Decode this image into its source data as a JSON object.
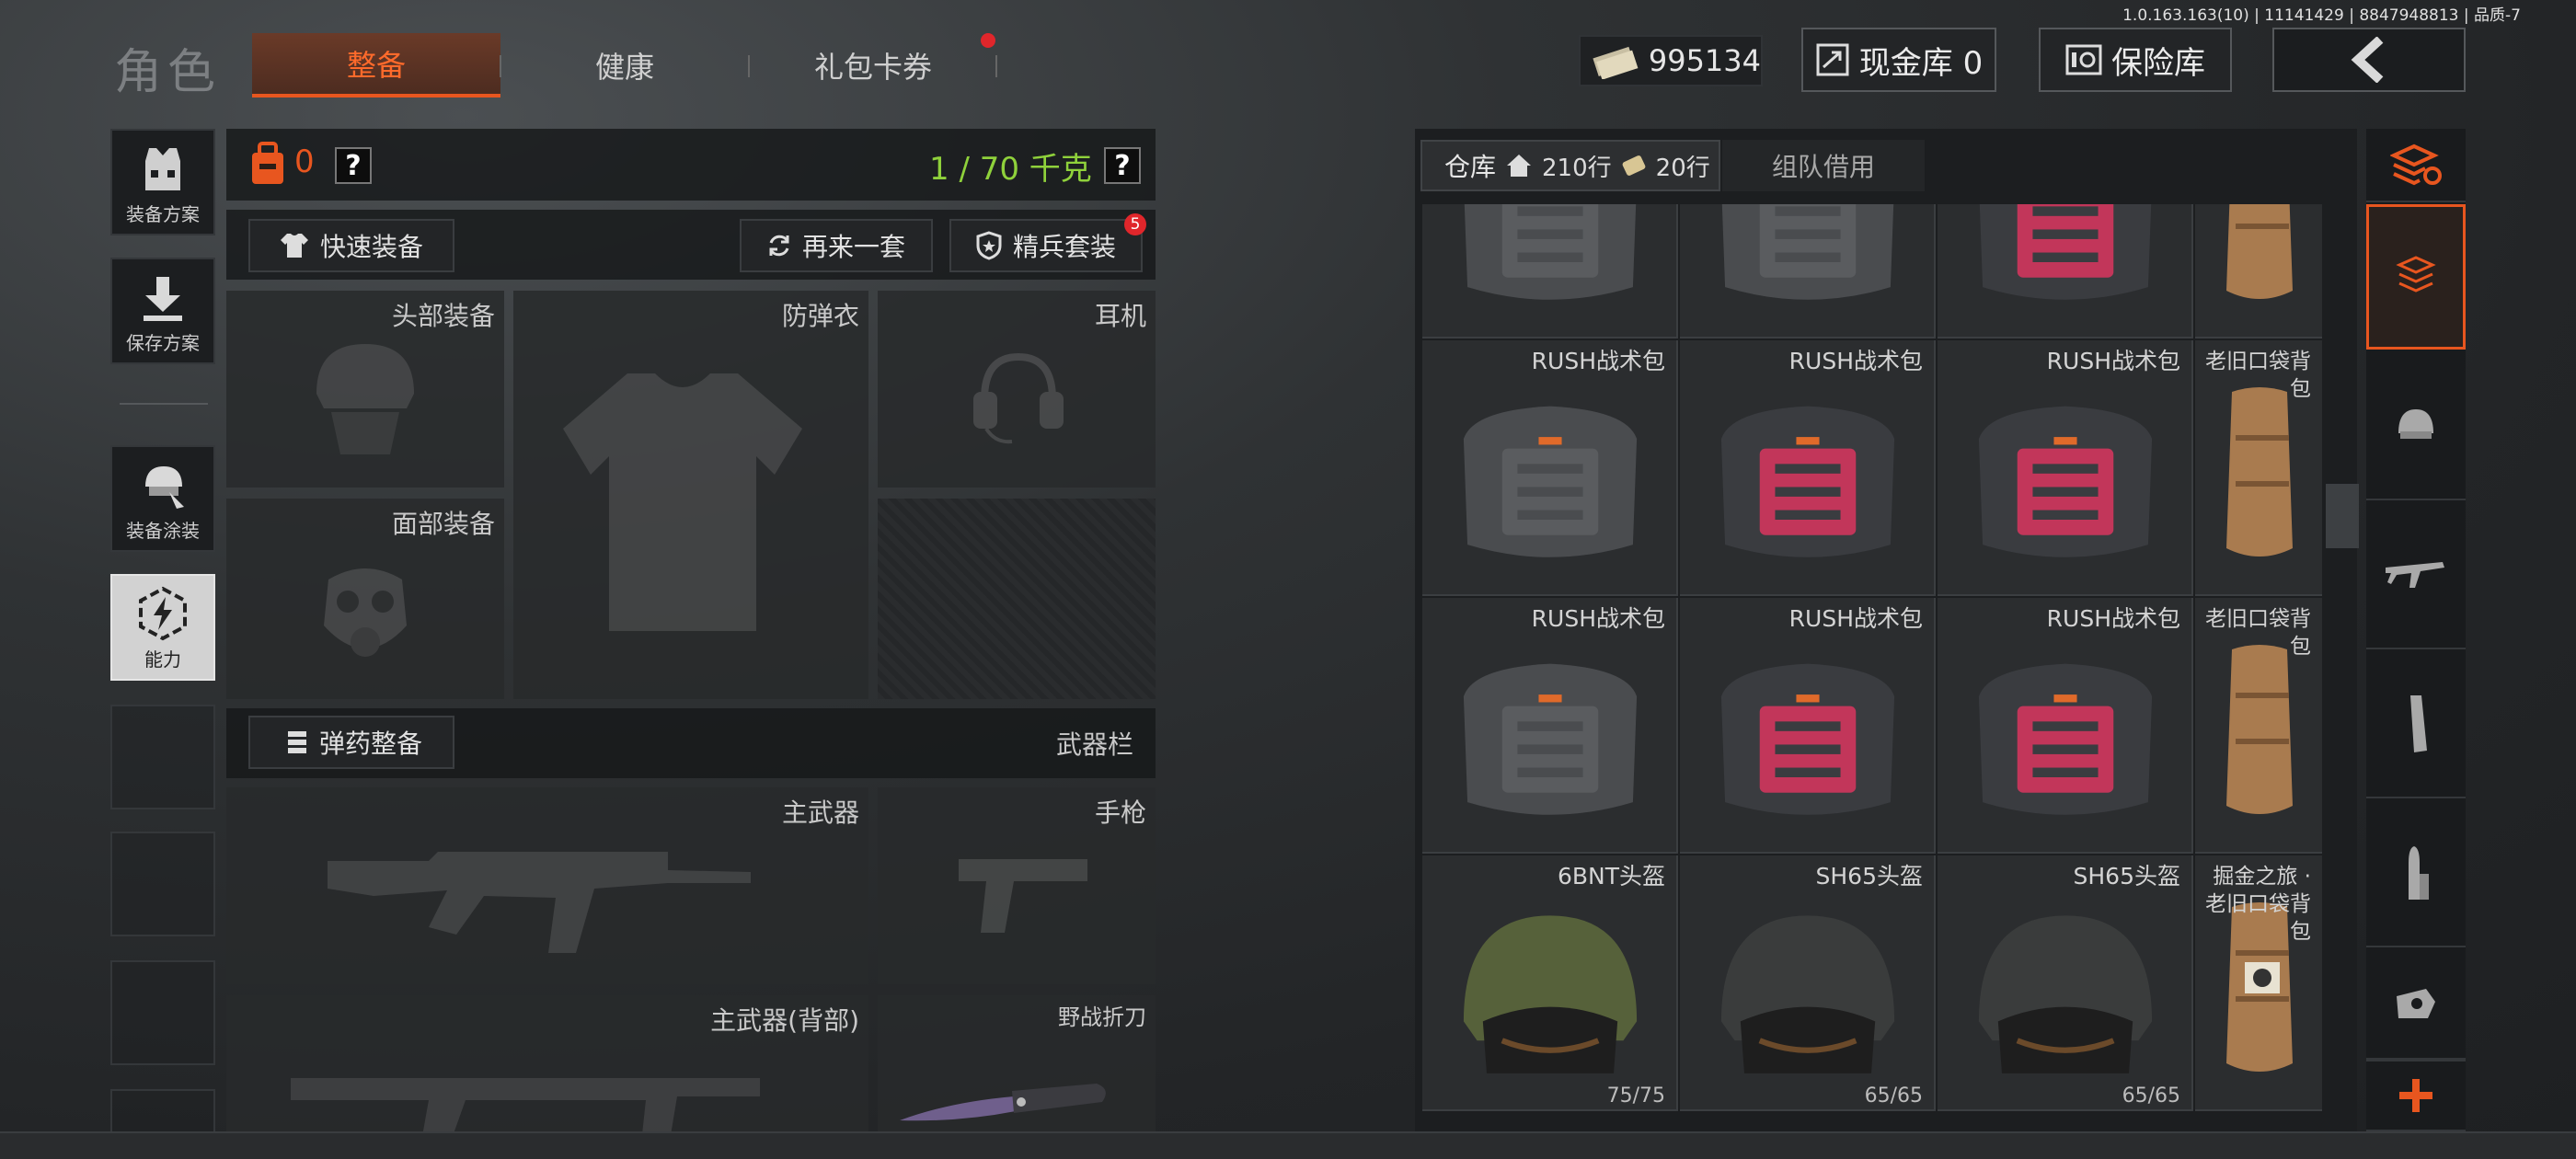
{
  "build_info": "1.0.163.163(10) | 11141429 | 8847948813 | 品质-7",
  "header": {
    "title": "角色",
    "tabs": [
      {
        "label": "整备",
        "active": true
      },
      {
        "label": "健康",
        "active": false
      },
      {
        "label": "礼包卡券",
        "active": false,
        "has_dot": true
      }
    ],
    "currency_value": "995134",
    "cash_vault_label": "现金库 0",
    "safe_vault_label": "保险库"
  },
  "left_sidebar": {
    "items": [
      {
        "label": "装备方案",
        "icon": "vest-icon"
      },
      {
        "label": "保存方案",
        "icon": "download-icon"
      },
      {
        "label": "装备涂装",
        "icon": "helmet-paint-icon"
      },
      {
        "label": "能力",
        "icon": "ability-icon"
      }
    ]
  },
  "loadout": {
    "bag_count": "0",
    "weight_text": "1 / 70 千克",
    "quick_equip": "快速装备",
    "retry_set": "再来一套",
    "elite_set": "精兵套装",
    "elite_badge": "5",
    "slots": {
      "head": "头部装备",
      "armor": "防弹衣",
      "headset": "耳机",
      "face": "面部装备"
    },
    "ammo_button": "弹药整备",
    "weapon_bar": "武器栏",
    "weapons": {
      "primary": "主武器",
      "pistol": "手枪",
      "primary_back": "主武器(背部)",
      "knife": "野战折刀"
    }
  },
  "warehouse": {
    "tab_label": "仓库",
    "rows_label": "210行",
    "extra_rows_label": "20行",
    "team_borrow": "组队借用",
    "grid": [
      [
        {
          "name": "",
          "item": "backpack-gray"
        },
        {
          "name": "",
          "item": "backpack-gray"
        },
        {
          "name": "",
          "item": "backpack-red"
        },
        {
          "name": "",
          "item": "sack"
        }
      ],
      [
        {
          "name": "RUSH战术包",
          "item": "backpack-gray"
        },
        {
          "name": "RUSH战术包",
          "item": "backpack-red"
        },
        {
          "name": "RUSH战术包",
          "item": "backpack-red"
        },
        {
          "name": "老旧口袋背包",
          "item": "sack"
        }
      ],
      [
        {
          "name": "RUSH战术包",
          "item": "backpack-gray"
        },
        {
          "name": "RUSH战术包",
          "item": "backpack-red"
        },
        {
          "name": "RUSH战术包",
          "item": "backpack-red"
        },
        {
          "name": "老旧口袋背包",
          "item": "sack"
        }
      ],
      [
        {
          "name": "6BNT头盔",
          "item": "helmet-green",
          "durability": "75/75"
        },
        {
          "name": "SH65头盔",
          "item": "helmet-black",
          "durability": "65/65"
        },
        {
          "name": "SH65头盔",
          "item": "helmet-black",
          "durability": "65/65"
        },
        {
          "name": "掘金之旅 · 老旧口袋背包",
          "item": "sack-marked"
        }
      ]
    ]
  },
  "right_tabs": [
    "stack-sort-icon",
    "armor-vest-icon",
    "helmet-icon",
    "rifle-icon",
    "magazine-icon",
    "ammo-icon",
    "scope-icon",
    "add-icon"
  ],
  "colors": {
    "accent_orange": "#e8561f",
    "weight_green": "#8fd13b",
    "badge_red": "#e0262b"
  }
}
